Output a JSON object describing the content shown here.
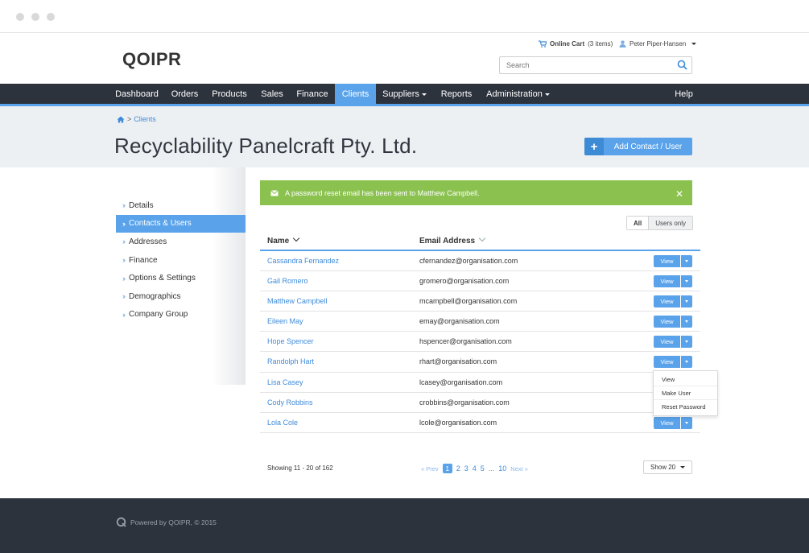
{
  "brand": {
    "logo_text": "QOIPR",
    "accent": "#5aa3ea",
    "dark": "#2d333d",
    "success": "#8bc24f"
  },
  "topbar": {
    "cart_label": "Online Cart",
    "cart_count": "(3 items)",
    "user_name": "Peter Piper-Hansen",
    "search_placeholder": "Search"
  },
  "nav": {
    "items": [
      {
        "label": "Dashboard"
      },
      {
        "label": "Orders"
      },
      {
        "label": "Products"
      },
      {
        "label": "Sales"
      },
      {
        "label": "Finance"
      },
      {
        "label": "Clients"
      },
      {
        "label": "Suppliers"
      },
      {
        "label": "Reports"
      },
      {
        "label": "Administration"
      },
      {
        "label": "Help"
      }
    ],
    "active": "Clients"
  },
  "breadcrumb": {
    "separator": ">",
    "current": "Clients"
  },
  "page": {
    "title": "Recyclability Panelcraft Pty. Ltd.",
    "add_button": "Add Contact / User"
  },
  "sidebar": {
    "items": [
      {
        "label": "Details"
      },
      {
        "label": "Contacts & Users"
      },
      {
        "label": "Addresses"
      },
      {
        "label": "Finance"
      },
      {
        "label": "Options & Settings"
      },
      {
        "label": "Demographics"
      },
      {
        "label": "Company Group"
      }
    ],
    "active": "Contacts & Users"
  },
  "alert": {
    "message": "A password reset email has been sent to Matthew Campbell."
  },
  "filter": {
    "all": "All",
    "users_only": "Users only"
  },
  "table": {
    "columns": {
      "name": "Name",
      "email": "Email Address"
    },
    "view_label": "View",
    "rows": [
      {
        "name": "Cassandra Fernandez",
        "email": "cfernandez@organisation.com",
        "has_button": true
      },
      {
        "name": "Gail Romero",
        "email": "gromero@organisation.com",
        "has_button": true
      },
      {
        "name": "Matthew Campbell",
        "email": "mcampbell@organisation.com",
        "has_button": true
      },
      {
        "name": "Eileen May",
        "email": "emay@organisation.com",
        "has_button": true
      },
      {
        "name": "Hope Spencer",
        "email": "hspencer@organisation.com",
        "has_button": true
      },
      {
        "name": "Randolph Hart",
        "email": "rhart@organisation.com",
        "has_button": true
      },
      {
        "name": "Lisa Casey",
        "email": "lcasey@organisation.com",
        "has_button": false
      },
      {
        "name": "Cody Robbins",
        "email": "crobbins@organisation.com",
        "has_button": false
      },
      {
        "name": "Lola Cole",
        "email": "lcole@organisation.com",
        "has_button": true
      }
    ]
  },
  "dropdown_menu": {
    "items": [
      "View",
      "Make User",
      "Reset Password"
    ]
  },
  "pagination": {
    "showing": "Showing 11 - 20 of 162",
    "prev": "Prev",
    "next": "Next",
    "pages": [
      "1",
      "2",
      "3",
      "4",
      "5",
      "...",
      "10"
    ],
    "current": "1",
    "show_select": "Show 20"
  },
  "footer": {
    "text": "Powered by QOIPR, © 2015"
  }
}
